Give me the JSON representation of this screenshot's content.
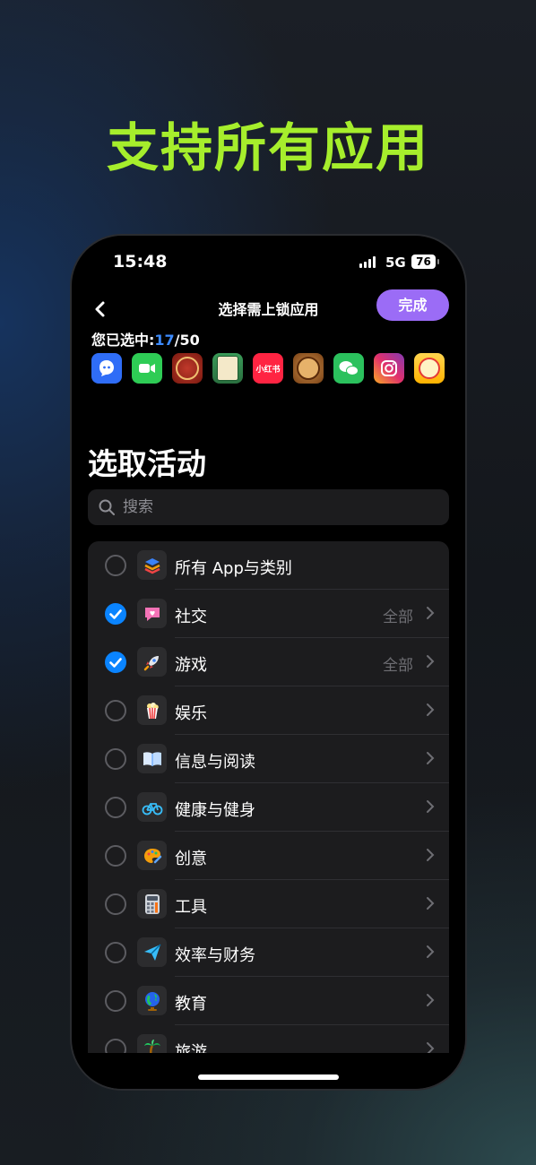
{
  "headline": "支持所有应用",
  "status_bar": {
    "time": "15:48",
    "network": "5G",
    "battery": "76"
  },
  "nav": {
    "title": "选择需上锁应用",
    "done_label": "完成"
  },
  "selection": {
    "label": "您已选中:",
    "current": "17",
    "separator": "/",
    "total": "50"
  },
  "selected_apps": [
    {
      "name": "qq-icon",
      "color": "#2f6df7"
    },
    {
      "name": "facetime-icon",
      "color": "#2ecc55"
    },
    {
      "name": "chinese-chess-icon",
      "color": "#8a1d14"
    },
    {
      "name": "mahjong-icon",
      "color": "#2f8a47"
    },
    {
      "name": "xiaohongshu-icon",
      "color": "#ff2442",
      "text": "小红书"
    },
    {
      "name": "chess-piece-icon",
      "color": "#9a5a1e"
    },
    {
      "name": "wechat-icon",
      "color": "#2bc15d"
    },
    {
      "name": "instagram-icon",
      "color": "#d62976"
    },
    {
      "name": "game-character-icon",
      "color": "#ffca28"
    }
  ],
  "section_title": "选取活动",
  "search": {
    "placeholder": "搜索"
  },
  "categories": [
    {
      "label": "所有 App与类别",
      "checked": false,
      "icon": "stack-icon"
    },
    {
      "label": "社交",
      "checked": true,
      "icon": "chat-heart-icon",
      "sub": "全部"
    },
    {
      "label": "游戏",
      "checked": true,
      "icon": "rocket-icon",
      "sub": "全部"
    },
    {
      "label": "娱乐",
      "checked": false,
      "icon": "popcorn-icon"
    },
    {
      "label": "信息与阅读",
      "checked": false,
      "icon": "book-icon"
    },
    {
      "label": "健康与健身",
      "checked": false,
      "icon": "bicycle-icon"
    },
    {
      "label": "创意",
      "checked": false,
      "icon": "palette-icon"
    },
    {
      "label": "工具",
      "checked": false,
      "icon": "calculator-icon"
    },
    {
      "label": "效率与财务",
      "checked": false,
      "icon": "paper-plane-icon"
    },
    {
      "label": "教育",
      "checked": false,
      "icon": "globe-icon"
    },
    {
      "label": "旅游",
      "checked": false,
      "icon": "palm-tree-icon"
    }
  ]
}
